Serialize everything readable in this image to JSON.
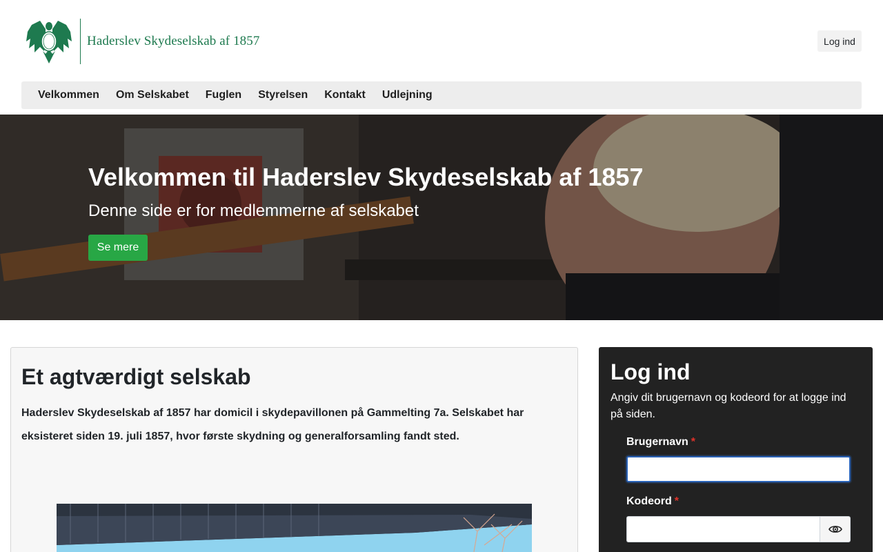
{
  "header": {
    "logo_text": "Haderslev Skydeselskab af 1857",
    "login_button": "Log ind"
  },
  "nav": {
    "items": [
      "Velkommen",
      "Om Selskabet",
      "Fuglen",
      "Styrelsen",
      "Kontakt",
      "Udlejning"
    ]
  },
  "hero": {
    "title": "Velkommen til Haderslev Skydeselskab af 1857",
    "subtitle": "Denne side er for medlemmerne af selskabet",
    "button": "Se mere"
  },
  "main": {
    "title": "Et agtværdigt selskab",
    "text": "Haderslev Skydeselskab af 1857 har domicil i skydepavillonen på Gammelting 7a. Selskabet har eksisteret siden 19. juli 1857, hvor første skydning og generalforsamling fandt sted."
  },
  "login": {
    "title": "Log ind",
    "description": "Angiv dit brugernavn og kodeord for at logge ind på siden.",
    "username_label": "Brugernavn",
    "password_label": "Kodeord",
    "required_mark": "*",
    "username_value": "",
    "password_value": ""
  },
  "icons": {
    "logo": "eagle-emblem-icon",
    "password_toggle": "eye-icon"
  },
  "colors": {
    "brand_green": "#1e7a4f",
    "button_green": "#28a745",
    "login_bg": "#222222",
    "required": "#e0322a",
    "focus": "#2a63b8"
  }
}
